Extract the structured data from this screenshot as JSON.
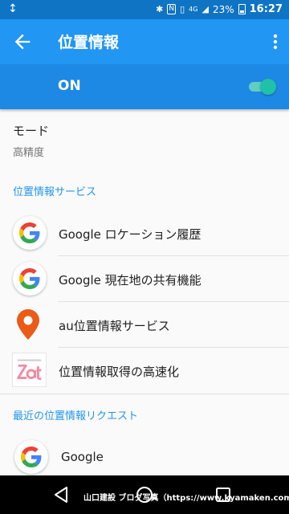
{
  "status_bar": {
    "left_icon": "usb-debug-icon",
    "battery_percent": "23%",
    "time": "16:27",
    "network": "4G",
    "icons": [
      "bluetooth-icon",
      "nfc-icon",
      "vibrate-icon",
      "signal-icon",
      "battery-icon"
    ]
  },
  "app_bar": {
    "title": "位置情報",
    "back_icon": "arrow-back-icon",
    "menu_icon": "more-vert-icon"
  },
  "master_switch": {
    "label": "ON",
    "checked": true,
    "colors": {
      "track": "#5fcfc0",
      "thumb": "#20c1a6"
    }
  },
  "mode": {
    "title": "モード",
    "value": "高精度"
  },
  "services": {
    "header": "位置情報サービス",
    "items": [
      {
        "label": "Google ロケーション履歴",
        "icon": "google-g-icon"
      },
      {
        "label": "Google 現在地の共有機能",
        "icon": "google-g-icon"
      },
      {
        "label": "au位置情報サービス",
        "icon": "location-pin-icon"
      },
      {
        "label": "位置情報取得の高速化",
        "icon": "qualcomm-izat-icon"
      }
    ]
  },
  "recent_requests": {
    "header": "最近の位置情報リクエスト",
    "items": [
      {
        "label": "Google",
        "icon": "google-g-icon"
      }
    ]
  },
  "nav_bar": {
    "watermark": "山口建設 ブログ写真（https://www.kyamaken.com）",
    "buttons": [
      "nav-back-icon",
      "nav-home-icon",
      "nav-recents-icon"
    ]
  },
  "colors": {
    "status_bar": "#0f74c3",
    "app_bar": "#2196f3",
    "switch_bar": "#1e88e5",
    "accent": "#2196f3"
  }
}
